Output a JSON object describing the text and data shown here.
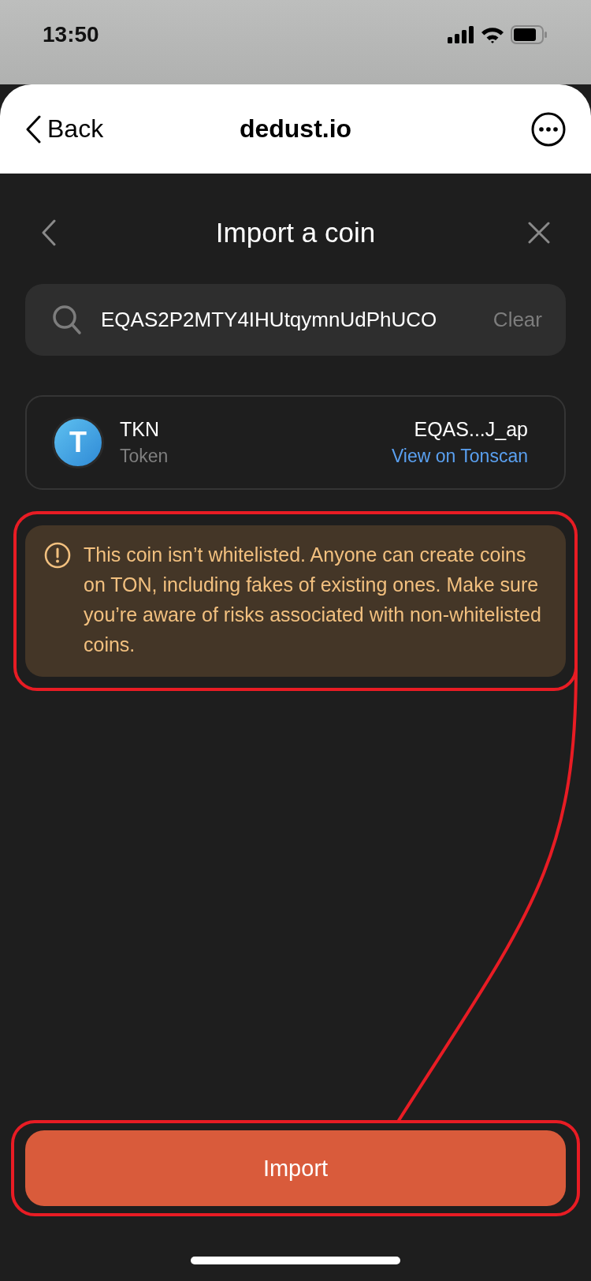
{
  "status_bar": {
    "time": "13:50"
  },
  "browser_header": {
    "back_label": "Back",
    "title": "dedust.io"
  },
  "sheet": {
    "title": "Import a coin"
  },
  "search": {
    "value": "EQAS2P2MTY4IHUtqymnUdPhUCO",
    "clear_label": "Clear"
  },
  "token": {
    "logo_letter": "T",
    "symbol": "TKN",
    "type": "Token",
    "address": "EQAS...J_ap",
    "link": "View on Tonscan"
  },
  "warning": {
    "text": "This coin isn’t whitelisted. Anyone can create coins on TON, including fakes of existing ones. Make sure you’re aware of risks associated with non-whitelisted coins.",
    "highlighted": true
  },
  "import_button": {
    "label": "Import",
    "highlighted": true
  }
}
